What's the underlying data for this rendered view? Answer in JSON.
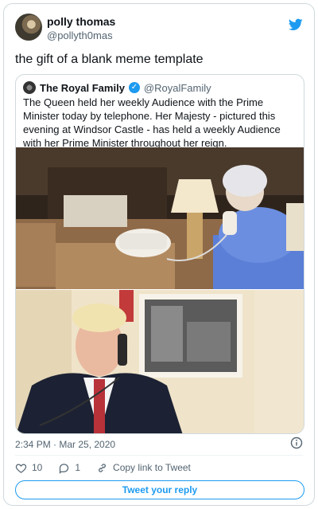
{
  "tweet": {
    "display_name": "polly thomas",
    "handle": "@pollyth0mas",
    "text": "the gift of a blank meme template",
    "timestamp": "2:34 PM · Mar 25, 2020",
    "like_count": "10",
    "reply_count": "1",
    "copy_link_label": "Copy link to Tweet",
    "reply_button_label": "Tweet your reply",
    "brand_color": "#1d9bf0",
    "bird_icon": "twitter-bird-icon"
  },
  "quoted": {
    "display_name": "The Royal Family",
    "handle": "@RoyalFamily",
    "verified": true,
    "text": "The Queen held her weekly Audience with the Prime Minister today by telephone. Her Majesty - pictured this evening at Windsor Castle - has held a weekly Audience with her Prime Minister throughout her reign."
  }
}
